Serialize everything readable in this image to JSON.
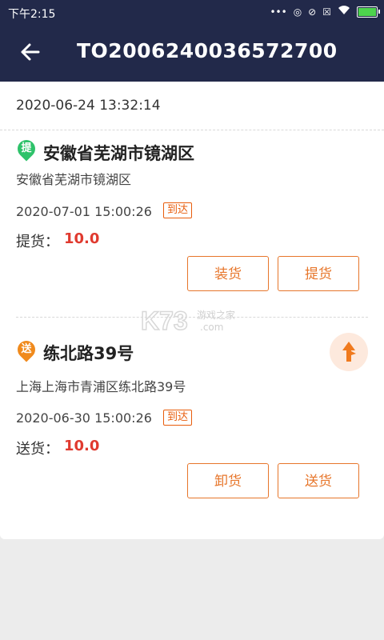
{
  "status_bar": {
    "time": "下午2:15",
    "icons": [
      "more-icon",
      "location-icon",
      "alarm-off-icon",
      "sim-icon",
      "wifi-icon",
      "battery-icon"
    ]
  },
  "header": {
    "title": "TO2006240036572700"
  },
  "order": {
    "created_at": "2020-06-24 13:32:14"
  },
  "pickup": {
    "pin_label": "提",
    "title": "安徽省芜湖市镜湖区",
    "address": "安徽省芜湖市镜湖区",
    "time": "2020-07-01 15:00:26",
    "badge": "到达",
    "qty_label": "提货：",
    "qty_value": "10.0",
    "btn1": "装货",
    "btn2": "提货"
  },
  "delivery": {
    "pin_label": "送",
    "title": "练北路39号",
    "address": "上海上海市青浦区练北路39号",
    "time": "2020-06-30 15:00:26",
    "badge": "到达",
    "qty_label": "送货：",
    "qty_value": "10.0",
    "btn1": "卸货",
    "btn2": "送货"
  },
  "watermark": {
    "logo": "K73",
    "text": "游戏之家",
    "domain": ".com"
  },
  "colors": {
    "header_bg": "#22294a",
    "accent": "#e7762b",
    "pickup_pin": "#2ec26a",
    "delivery_pin": "#f08a1c",
    "qty": "#e03a2f"
  }
}
